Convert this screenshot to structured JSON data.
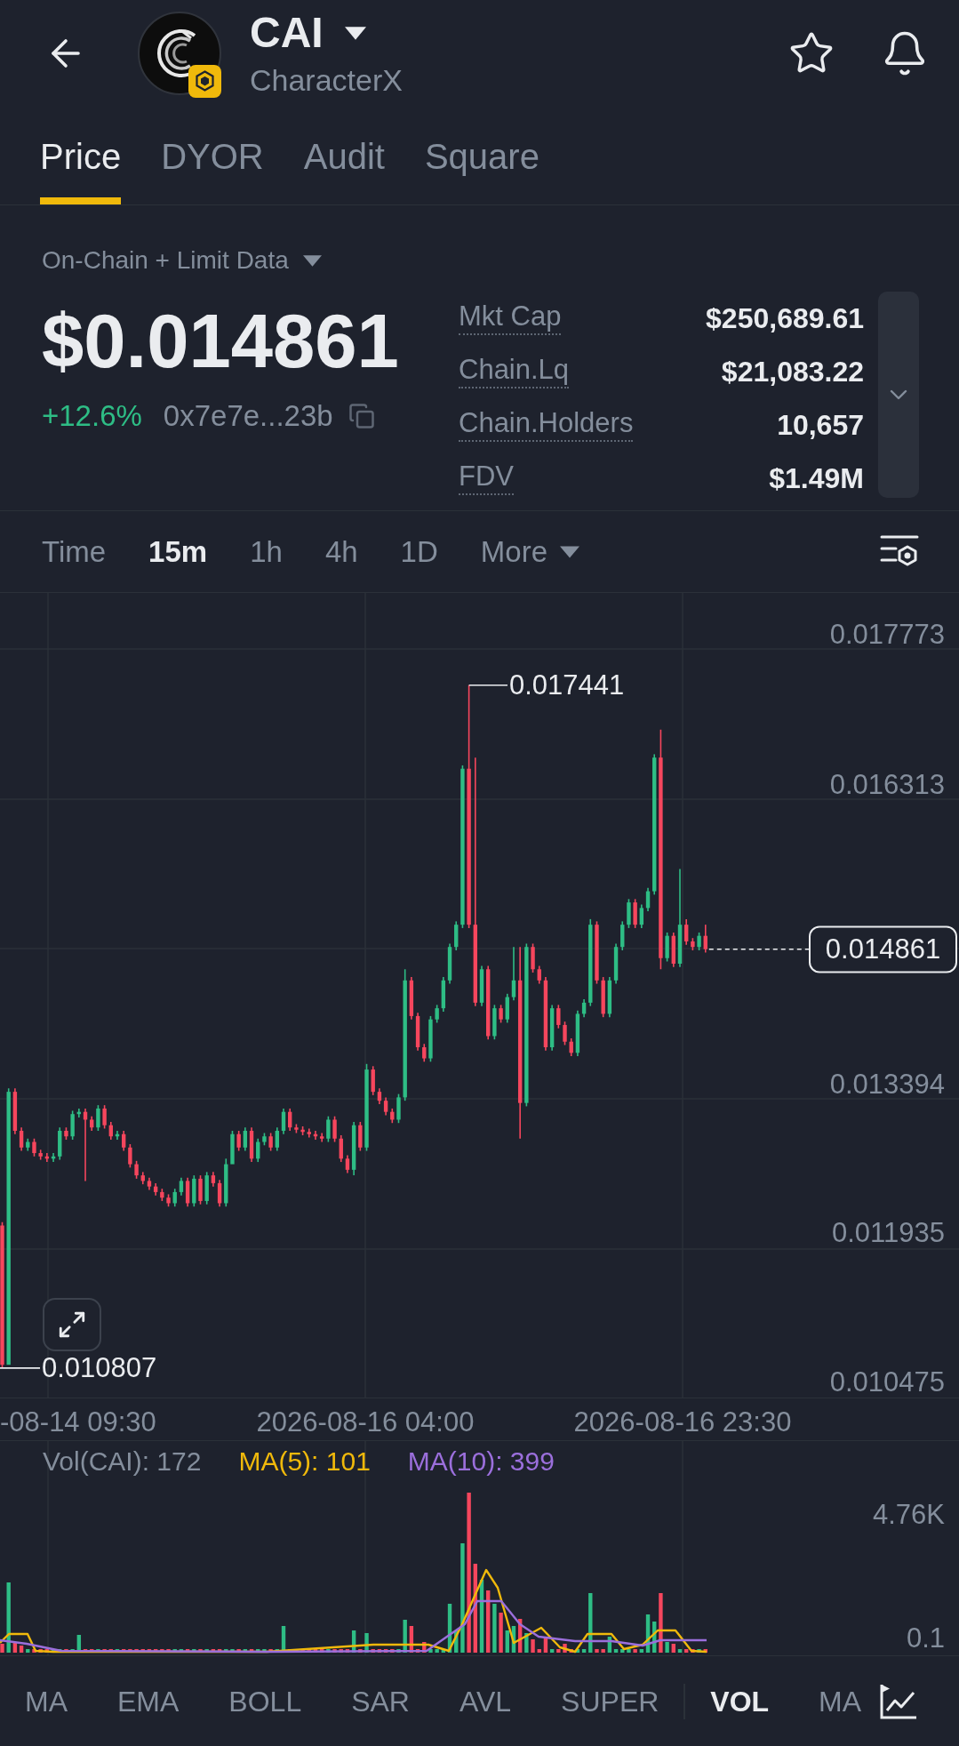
{
  "header": {
    "title": "CAI",
    "subtitle": "CharacterX"
  },
  "tabs": [
    {
      "label": "Price",
      "selected": true
    },
    {
      "label": "DYOR",
      "selected": false
    },
    {
      "label": "Audit",
      "selected": false
    },
    {
      "label": "Square",
      "selected": false
    }
  ],
  "data_source": {
    "label": "On-Chain + Limit Data"
  },
  "price": {
    "value": "$0.014861",
    "change": "+12.6%",
    "address": "0x7e7e...23b"
  },
  "stats": [
    {
      "label": "Mkt Cap",
      "value": "$250,689.61"
    },
    {
      "label": "Chain.Lq",
      "value": "$21,083.22"
    },
    {
      "label": "Chain.Holders",
      "value": "10,657"
    },
    {
      "label": "FDV",
      "value": "$1.49M"
    }
  ],
  "intervals": [
    {
      "label": "Time",
      "selected": false
    },
    {
      "label": "15m",
      "selected": true
    },
    {
      "label": "1h",
      "selected": false
    },
    {
      "label": "4h",
      "selected": false
    },
    {
      "label": "1D",
      "selected": false
    }
  ],
  "more_menu": {
    "label": "More"
  },
  "price_chart": {
    "price_ticks": [
      "0.017773",
      "0.016313",
      "0.013394",
      "0.011935",
      "0.010475"
    ],
    "time_labels": [
      "-08-14 09:30",
      "2026-08-16 04:00",
      "2026-08-16 23:30"
    ],
    "high_label": "0.017441",
    "low_label": "0.010807",
    "last_price": "0.014861"
  },
  "volume_chart": {
    "legend": [
      {
        "label": "Vol(CAI): 172",
        "color": "#848e9c"
      },
      {
        "label": "MA(5): 101",
        "color": "#f0b90b"
      },
      {
        "label": "MA(10): 399",
        "color": "#9b6fdc"
      }
    ],
    "ticks": [
      "4.76K",
      "0.1"
    ]
  },
  "main_indicators": [
    {
      "label": "MA",
      "selected": false
    },
    {
      "label": "EMA",
      "selected": false
    },
    {
      "label": "BOLL",
      "selected": false
    },
    {
      "label": "SAR",
      "selected": false
    },
    {
      "label": "AVL",
      "selected": false
    },
    {
      "label": "SUPER",
      "selected": false
    }
  ],
  "sub_indicators": [
    {
      "label": "VOL",
      "selected": true
    },
    {
      "label": "MA",
      "selected": false
    }
  ]
}
